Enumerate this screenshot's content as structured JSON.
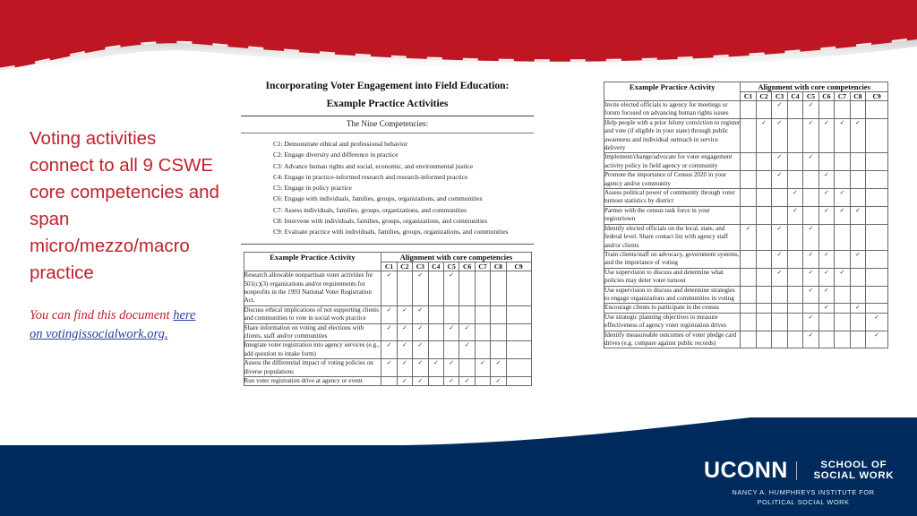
{
  "colors": {
    "banner_red": "#BE1622",
    "footer_navy": "#002B5C",
    "text_red": "#C0202C",
    "link_blue": "#2B3FA0"
  },
  "left_panel": {
    "heading": "Voting activities connect to all 9 CSWE core competencies and span micro/mezzo/macro practice",
    "note_prefix": "You can find this document ",
    "note_link": "here on votingissocialwork.org.",
    "note_link_part1": "here",
    "note_link_part2": "on votingissocialwork.org."
  },
  "document": {
    "title_line1": "Incorporating Voter Engagement into Field Education:",
    "title_line2": "Example Practice Activities",
    "competencies_heading": "The Nine Competencies:",
    "competencies": [
      "C1: Demonstrate ethical and professional behavior",
      "C2: Engage diversity and difference in practice",
      "C3: Advance human rights and social, economic, and environmental justice",
      "C4: Engage in practice-informed research and research-informed practice",
      "C5: Engage in policy practice",
      "C6: Engage with individuals, families, groups, organizations, and communities",
      "C7: Assess individuals, families, groups, organizations, and communities",
      "C8: Intervene with individuals, families, groups, organizations, and communities",
      "C9: Evaluate practice with individuals, families, groups, organizations, and communities"
    ],
    "table_headers": {
      "activity": "Example Practice Activity",
      "alignment": "Alignment with core competencies",
      "competency_columns": [
        "C1",
        "C2",
        "C3",
        "C4",
        "C5",
        "C6",
        "C7",
        "C8",
        "C9"
      ]
    },
    "check_mark": "✓",
    "table_left_rows": [
      {
        "activity": "Research allowable nonpartisan voter activities for 501(c)(3) organizations and/or requirements for nonprofits in the 1993 National Voter Registration Act.",
        "checks": [
          true,
          false,
          true,
          false,
          true,
          false,
          false,
          false,
          false
        ]
      },
      {
        "activity": "Discuss ethical implications of not supporting clients and communities to vote in social work practice",
        "checks": [
          true,
          true,
          true,
          false,
          false,
          false,
          false,
          false,
          false
        ]
      },
      {
        "activity": "Share information on voting and elections with clients, staff and/or communities",
        "checks": [
          true,
          true,
          true,
          false,
          true,
          true,
          false,
          false,
          false
        ]
      },
      {
        "activity": "Integrate voter registration into agency services (e.g., add question to intake form)",
        "checks": [
          true,
          true,
          true,
          false,
          false,
          true,
          false,
          false,
          false
        ]
      },
      {
        "activity": "Assess the differential impact of voting policies on diverse populations",
        "checks": [
          true,
          true,
          true,
          true,
          true,
          false,
          true,
          true,
          false
        ]
      },
      {
        "activity": "Run voter registration drive at agency or event",
        "checks": [
          false,
          true,
          true,
          false,
          true,
          true,
          false,
          true,
          false
        ]
      }
    ],
    "table_right_rows": [
      {
        "activity": "Invite elected officials to agency for meetings or forum focused on advancing human rights issues",
        "checks": [
          false,
          false,
          true,
          false,
          true,
          false,
          false,
          false,
          false
        ]
      },
      {
        "activity": "Help people with a prior felony conviction to register and vote (if eligible in your state) through public awareness and individual outreach in service delivery",
        "checks": [
          false,
          true,
          true,
          false,
          true,
          true,
          true,
          true,
          false
        ]
      },
      {
        "activity": "Implement/change/advocate for voter engagement activity policy in field agency or community",
        "checks": [
          false,
          false,
          true,
          false,
          true,
          false,
          false,
          false,
          false
        ]
      },
      {
        "activity": "Promote the importance of Census 2020 in your agency and/or community",
        "checks": [
          false,
          false,
          true,
          false,
          false,
          true,
          false,
          false,
          false
        ]
      },
      {
        "activity": "Assess political power of community through voter turnout statistics by district",
        "checks": [
          false,
          false,
          false,
          true,
          false,
          true,
          true,
          false,
          false
        ]
      },
      {
        "activity": "Partner with the census task force in your region/town",
        "checks": [
          false,
          false,
          false,
          true,
          false,
          true,
          true,
          true,
          false
        ]
      },
      {
        "activity": "Identify elected officials on the local, state, and federal level. Share contact list with agency staff and/or clients",
        "checks": [
          true,
          false,
          true,
          false,
          true,
          false,
          false,
          false,
          false
        ]
      },
      {
        "activity": "Train clients/staff on advocacy, government systems, and the importance of voting",
        "checks": [
          false,
          false,
          true,
          false,
          true,
          true,
          false,
          true,
          false
        ]
      },
      {
        "activity": "Use supervision to discuss and determine what policies may deter voter turnout",
        "checks": [
          false,
          false,
          true,
          false,
          true,
          true,
          true,
          false,
          false
        ]
      },
      {
        "activity": "Use supervision to discuss and determine strategies to engage organizations and communities in voting",
        "checks": [
          false,
          false,
          false,
          false,
          true,
          true,
          false,
          false,
          false
        ]
      },
      {
        "activity": "Encourage clients to participate in the census",
        "checks": [
          false,
          false,
          false,
          false,
          false,
          true,
          false,
          true,
          false
        ]
      },
      {
        "activity": "Use strategic planning objectives to measure effectiveness of agency voter registration drives",
        "checks": [
          false,
          false,
          false,
          false,
          true,
          false,
          false,
          false,
          true
        ]
      },
      {
        "activity": "Identify measureable outcomes of voter pledge card drives (e.g. compare against public records)",
        "checks": [
          false,
          false,
          false,
          false,
          true,
          false,
          false,
          false,
          true
        ]
      }
    ]
  },
  "footer": {
    "logo_primary": "UCONN",
    "logo_secondary": "SCHOOL OF SOCIAL WORK",
    "logo_subline1": "NANCY A. HUMPHREYS INSTITUTE FOR",
    "logo_subline2": "POLITICAL SOCIAL WORK"
  }
}
